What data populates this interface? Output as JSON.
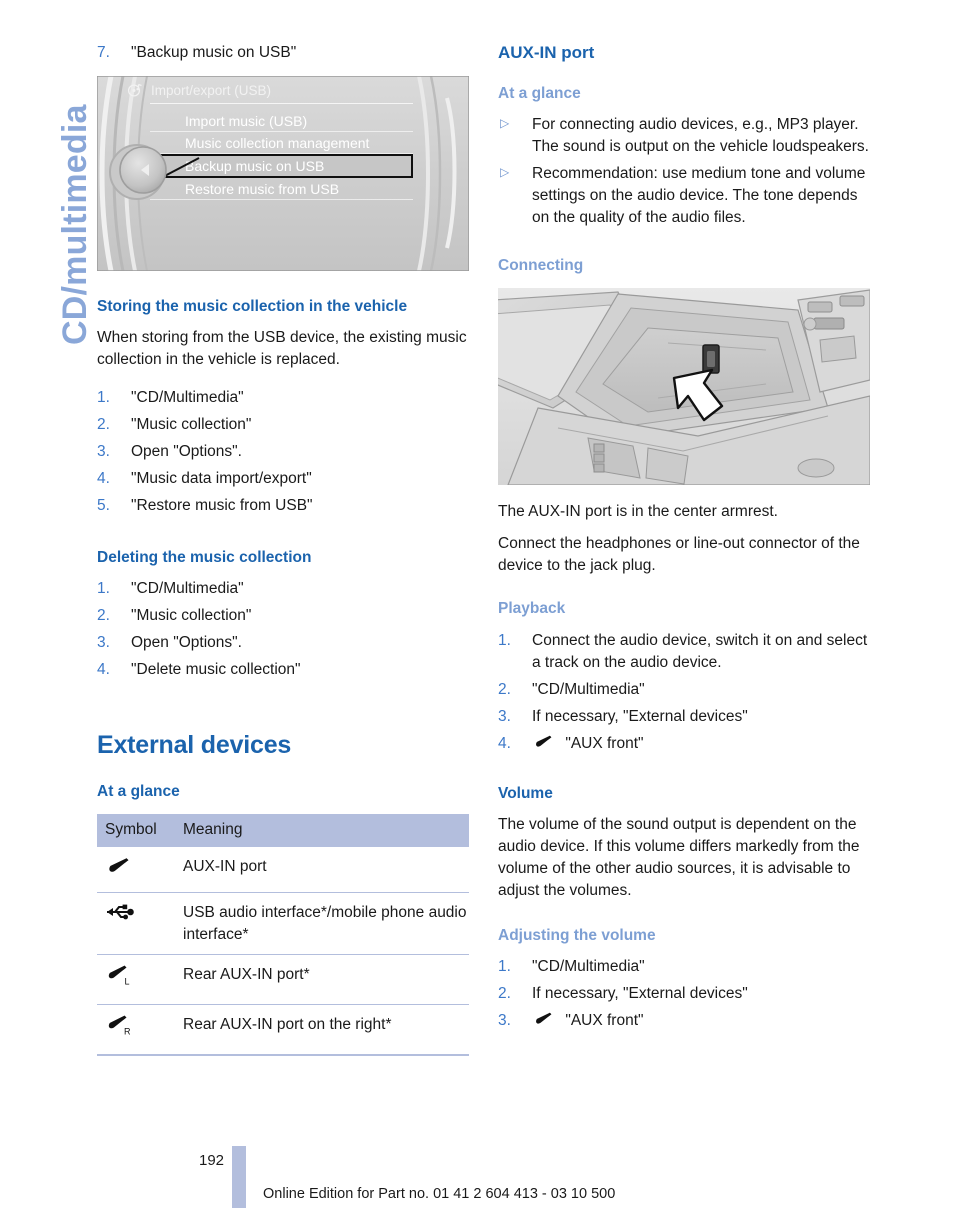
{
  "chapter_tab": {
    "label": "CD/multimedia"
  },
  "colors": {
    "heading_dark_blue": "#1b63ad",
    "heading_light_blue": "#7d9fd3",
    "list_number_blue": "#3c78c8",
    "table_header_bg": "#b3bedd",
    "page_bar": "#b3bedd"
  },
  "left_column": {
    "step7": {
      "num": "7.",
      "text": "\"Backup music on USB\""
    },
    "idrive": {
      "header_title": "Import/export (USB)",
      "header_icon": "music-disc-icon",
      "menu_items": [
        {
          "label": "Import music (USB)",
          "selected": false
        },
        {
          "label": "Music collection management",
          "selected": false
        },
        {
          "label": "Backup music on USB",
          "selected": true
        },
        {
          "label": "Restore music from USB",
          "selected": false
        }
      ],
      "controller_icon": "left-arrow-knob-icon"
    },
    "storing": {
      "heading": "Storing the music collection in the vehicle",
      "body": "When storing from the USB device, the existing music collection in the vehicle is replaced.",
      "steps": [
        {
          "num": "1.",
          "text": "\"CD/Multimedia\""
        },
        {
          "num": "2.",
          "text": "\"Music collection\""
        },
        {
          "num": "3.",
          "text": "Open \"Options\"."
        },
        {
          "num": "4.",
          "text": "\"Music data import/export\""
        },
        {
          "num": "5.",
          "text": "\"Restore music from USB\""
        }
      ]
    },
    "deleting": {
      "heading": "Deleting the music collection",
      "steps": [
        {
          "num": "1.",
          "text": "\"CD/Multimedia\""
        },
        {
          "num": "2.",
          "text": "\"Music collection\""
        },
        {
          "num": "3.",
          "text": "Open \"Options\"."
        },
        {
          "num": "4.",
          "text": "\"Delete music collection\""
        }
      ]
    },
    "external_devices": {
      "title": "External devices",
      "at_a_glance_heading": "At a glance",
      "table": {
        "headers": [
          "Symbol",
          "Meaning"
        ],
        "rows": [
          {
            "icon": "aux-jack-icon",
            "meaning": "AUX-IN port"
          },
          {
            "icon": "usb-icon",
            "meaning": "USB audio interface*/mobile phone audio interface*"
          },
          {
            "icon": "aux-jack-left-icon",
            "meaning": "Rear AUX-IN port*"
          },
          {
            "icon": "aux-jack-right-icon",
            "meaning": "Rear AUX-IN port on the right*"
          }
        ]
      }
    }
  },
  "right_column": {
    "aux_in_port": {
      "title": "AUX-IN port",
      "at_a_glance_heading": "At a glance",
      "bullets": [
        "For connecting audio devices, e.g., MP3 player. The sound is output on the vehicle loudspeakers.",
        "Recommendation: use medium tone and volume settings on the audio device. The tone depends on the quality of the audio files."
      ]
    },
    "connecting": {
      "heading": "Connecting",
      "photo_alt": "center-armrest-aux-port-illustration",
      "para1": "The AUX-IN port is in the center armrest.",
      "para2": "Connect the headphones or line-out connector of the device to the jack plug."
    },
    "playback": {
      "heading": "Playback",
      "steps": [
        {
          "num": "1.",
          "text": "Connect the audio device, switch it on and select a track on the audio device.",
          "icon": null
        },
        {
          "num": "2.",
          "text": "\"CD/Multimedia\"",
          "icon": null
        },
        {
          "num": "3.",
          "text": "If necessary, \"External devices\"",
          "icon": null
        },
        {
          "num": "4.",
          "text": "\"AUX front\"",
          "icon": "aux-jack-icon"
        }
      ]
    },
    "volume": {
      "heading": "Volume",
      "body": "The volume of the sound output is dependent on the audio device. If this volume differs markedly from the volume of the other audio sources, it is advisable to adjust the volumes."
    },
    "adjusting": {
      "heading": "Adjusting the volume",
      "steps": [
        {
          "num": "1.",
          "text": "\"CD/Multimedia\"",
          "icon": null
        },
        {
          "num": "2.",
          "text": "If necessary, \"External devices\"",
          "icon": null
        },
        {
          "num": "3.",
          "text": "\"AUX front\"",
          "icon": "aux-jack-icon"
        }
      ]
    }
  },
  "footer": {
    "page_number": "192",
    "edition": "Online Edition for Part no. 01 41 2 604 413 - 03 10 500"
  }
}
